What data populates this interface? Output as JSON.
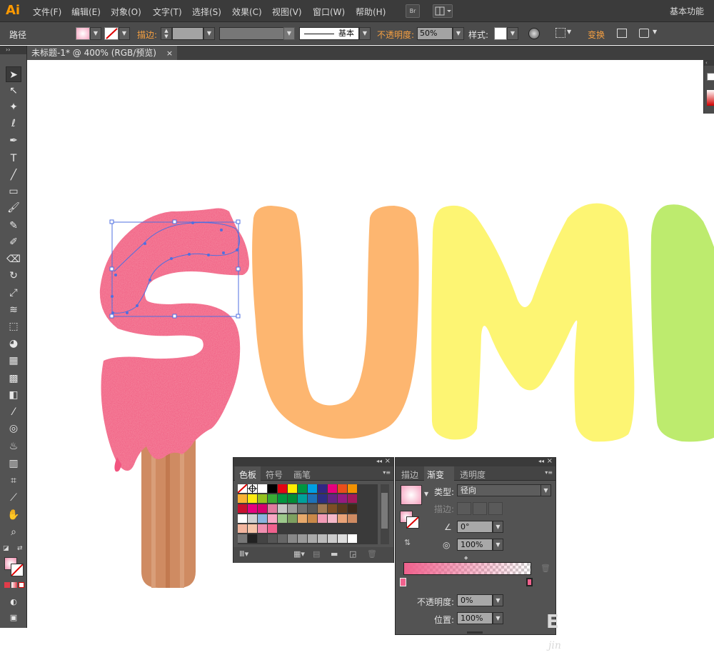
{
  "app": {
    "logo": "Ai",
    "workspace": "基本功能"
  },
  "menu": [
    "文件(F)",
    "编辑(E)",
    "对象(O)",
    "文字(T)",
    "选择(S)",
    "效果(C)",
    "视图(V)",
    "窗口(W)",
    "帮助(H)"
  ],
  "control_bar": {
    "object_type": "路径",
    "stroke_label": "描边:",
    "stroke_style": "基本",
    "opacity_label": "不透明度:",
    "opacity_value": "50%",
    "style_label": "样式:",
    "transform_label": "变换"
  },
  "document_tab": {
    "title": "未标题-1* @ 400% (RGB/预览)",
    "close": "×"
  },
  "artwork": {
    "letters": [
      "S",
      "U",
      "M",
      "M"
    ],
    "colors": {
      "pink": "#f2547f",
      "orange": "#fdb670",
      "yellow": "#fdf573",
      "green": "#bdeb6e",
      "stick": "#cf8b62"
    }
  },
  "swatches_panel": {
    "tabs": [
      "色板",
      "符号",
      "画笔"
    ]
  },
  "gradient_panel": {
    "tabs": [
      "描边",
      "渐变",
      "透明度"
    ],
    "type_label": "类型:",
    "type_value": "径向",
    "stroke_label": "描边:",
    "angle_value": "0°",
    "aspect_value": "100%",
    "opacity_label": "不透明度:",
    "opacity_value": "0%",
    "location_label": "位置:",
    "location_value": "100%"
  },
  "colors": {
    "ui_dark": "#3b3b3b",
    "ui_panel": "#535353",
    "accent_orange": "#f7a041",
    "gradient_start": "#f0618d"
  }
}
